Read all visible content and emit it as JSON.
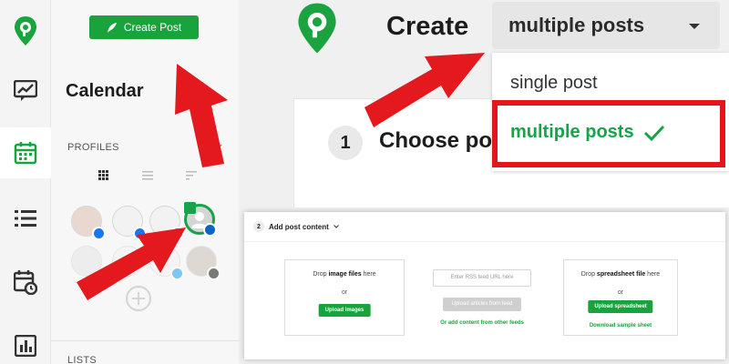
{
  "sidebar": {
    "create_post_label": "Create Post",
    "title": "Calendar",
    "profiles_label": "PROFILES",
    "lists_label": "LISTS"
  },
  "header": {
    "create_word": "Create",
    "post_type_selected": "multiple posts"
  },
  "dropdown_menu": {
    "options": [
      "single post",
      "multiple posts"
    ],
    "selected_index": 1
  },
  "step1": {
    "number": "1",
    "title": "Choose po"
  },
  "add_content": {
    "number": "2",
    "title": "Add post content",
    "images": {
      "title_pre": "Drop ",
      "title_bold": "image files",
      "title_post": " here",
      "or": "or",
      "button": "Upload images"
    },
    "rss": {
      "placeholder": "Enter RSS feed URL here",
      "button": "Upload articles from feed",
      "link": "Or add content from other feeds"
    },
    "spreadsheet": {
      "title_pre": "Drop ",
      "title_bold": "spreadsheet file",
      "title_post": " here",
      "or": "or",
      "button": "Upload spreadsheet",
      "link": "Download sample sheet"
    }
  },
  "colors": {
    "brand_green": "#18a33c",
    "highlight_red": "#e4161c",
    "arrow_red": "#e3191d"
  }
}
